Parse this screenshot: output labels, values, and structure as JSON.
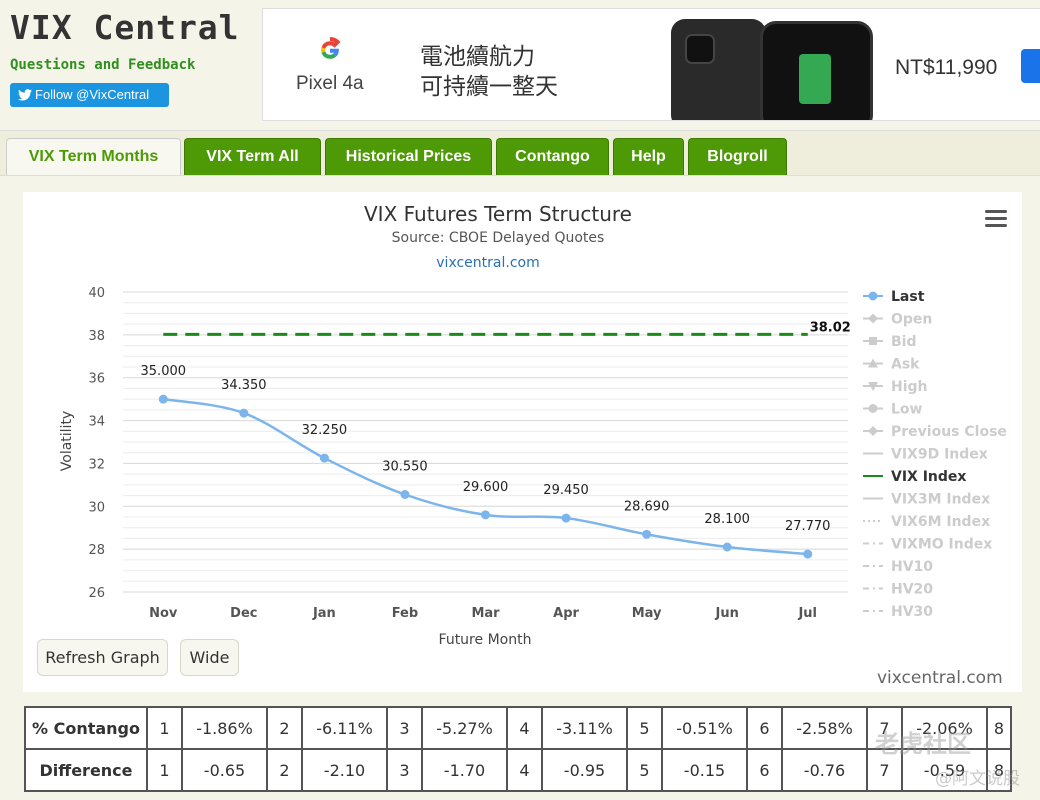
{
  "header": {
    "title": "VIX Central",
    "feedback_link": "Questions and Feedback",
    "follow_label": "Follow @VixCentral"
  },
  "ad": {
    "product": "Pixel 4a",
    "line1": "電池續航力",
    "line2": "可持續一整天",
    "price": "NT$11,990"
  },
  "tabs": [
    {
      "label": "VIX Term Months",
      "active": true
    },
    {
      "label": "VIX Term All",
      "active": false
    },
    {
      "label": "Historical Prices",
      "active": false
    },
    {
      "label": "Contango",
      "active": false
    },
    {
      "label": "Help",
      "active": false
    },
    {
      "label": "Blogroll",
      "active": false
    }
  ],
  "chart_data": {
    "type": "line",
    "title": "VIX Futures Term Structure",
    "subtitle": "Source: CBOE Delayed Quotes",
    "site_label": "vixcentral.com",
    "xlabel": "Future Month",
    "ylabel": "Volatility",
    "categories": [
      "Nov",
      "Dec",
      "Jan",
      "Feb",
      "Mar",
      "Apr",
      "May",
      "Jun",
      "Jul"
    ],
    "ylim": [
      26,
      40
    ],
    "yticks": [
      "26",
      "28",
      "30",
      "32",
      "34",
      "36",
      "38",
      "40"
    ],
    "grid": true,
    "legend_position": "right",
    "series": [
      {
        "name": "Last",
        "values": [
          35.0,
          34.35,
          32.25,
          30.55,
          29.6,
          29.45,
          28.69,
          28.1,
          27.77
        ],
        "labels": [
          "35.000",
          "34.350",
          "32.250",
          "30.550",
          "29.600",
          "29.450",
          "28.690",
          "28.100",
          "27.770"
        ],
        "color": "#7cb5ec"
      },
      {
        "name": "VIX Index",
        "value": 38.02,
        "label": "38.02",
        "color": "#1a8a1a",
        "dashed": true
      }
    ],
    "legend": [
      {
        "name": "Last",
        "enabled": true,
        "symbol": "circle-line"
      },
      {
        "name": "Open",
        "enabled": false,
        "symbol": "diamond-line"
      },
      {
        "name": "Bid",
        "enabled": false,
        "symbol": "square-line"
      },
      {
        "name": "Ask",
        "enabled": false,
        "symbol": "triangle-line"
      },
      {
        "name": "High",
        "enabled": false,
        "symbol": "triangle-down-line"
      },
      {
        "name": "Low",
        "enabled": false,
        "symbol": "circle-line"
      },
      {
        "name": "Previous Close",
        "enabled": false,
        "symbol": "diamond-line"
      },
      {
        "name": "VIX9D Index",
        "enabled": false,
        "symbol": "line"
      },
      {
        "name": "VIX Index",
        "enabled": true,
        "symbol": "line",
        "color": "#1a8a1a"
      },
      {
        "name": "VIX3M Index",
        "enabled": false,
        "symbol": "line"
      },
      {
        "name": "VIX6M Index",
        "enabled": false,
        "symbol": "dotted"
      },
      {
        "name": "VIXMO Index",
        "enabled": false,
        "symbol": "dashdot"
      },
      {
        "name": "HV10",
        "enabled": false,
        "symbol": "dashdot"
      },
      {
        "name": "HV20",
        "enabled": false,
        "symbol": "dashdot"
      },
      {
        "name": "HV30",
        "enabled": false,
        "symbol": "dashdot"
      }
    ]
  },
  "buttons": {
    "refresh": "Refresh Graph",
    "wide": "Wide"
  },
  "credit": "vixcentral.com",
  "table": {
    "rows": [
      {
        "label": "% Contango",
        "cells": [
          "1",
          "-1.86%",
          "2",
          "-6.11%",
          "3",
          "-5.27%",
          "4",
          "-3.11%",
          "5",
          "-0.51%",
          "6",
          "-2.58%",
          "7",
          "-2.06%",
          "8"
        ]
      },
      {
        "label": "Difference",
        "cells": [
          "1",
          "-0.65",
          "2",
          "-2.10",
          "3",
          "-1.70",
          "4",
          "-0.95",
          "5",
          "-0.15",
          "6",
          "-0.76",
          "7",
          "-0.59",
          "8"
        ]
      }
    ]
  },
  "watermark": {
    "text1": "老虎社区",
    "text2": "@阿文说股"
  },
  "colors": {
    "tab_green": "#4e9a06",
    "series_last": "#7cb5ec",
    "vix_index": "#1a8a1a"
  }
}
